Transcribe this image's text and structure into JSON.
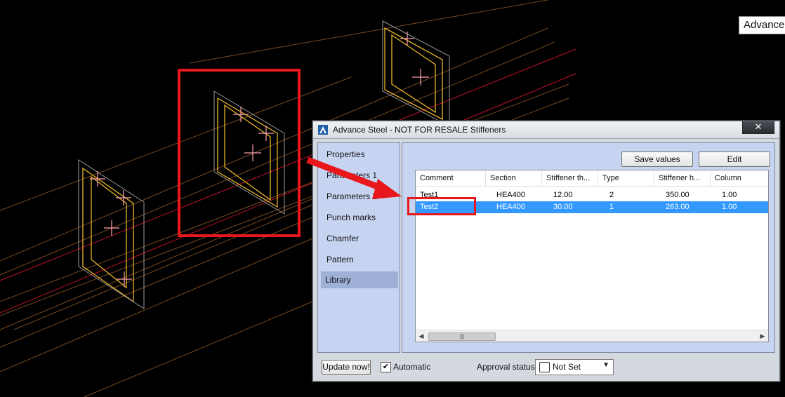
{
  "tooltip": {
    "text": "Advance"
  },
  "window": {
    "title": "Advance Steel - NOT FOR RESALE  Stiffeners",
    "close_label": "✕"
  },
  "nav": {
    "items": [
      "Properties",
      "Parameters 1",
      "Parameters 2",
      "Punch marks",
      "Chamfer",
      "Pattern",
      "Library"
    ],
    "active": "Library"
  },
  "toolbar": {
    "save_values": "Save values",
    "edit": "Edit"
  },
  "table": {
    "columns": [
      "Comment",
      "Section",
      "Stiffener th...",
      "Type",
      "Stiffener h...",
      "Column"
    ],
    "rows": [
      {
        "comment": "Test1",
        "section": "HEA400",
        "thickness": "12.00",
        "type": "2",
        "height": "350.00",
        "column": "1.00"
      },
      {
        "comment": "Test2",
        "section": "HEA400",
        "thickness": "30.00",
        "type": "1",
        "height": "263.00",
        "column": "1.00"
      }
    ],
    "selected_row": 1
  },
  "bottom": {
    "update_now": "Update now!",
    "automatic_label": "Automatic",
    "automatic_checked": true,
    "approval_label": "Approval status",
    "approval_value": "Not Set"
  },
  "colors": {
    "selection": "#3399ff",
    "nav_bg": "#c7d4f1",
    "highlight": "#e8171c"
  },
  "icons": [
    "advance-steel-logo-icon",
    "close-icon",
    "checkmark-icon",
    "dropdown-arrow-icon",
    "scroll-left-icon",
    "scroll-right-icon"
  ]
}
